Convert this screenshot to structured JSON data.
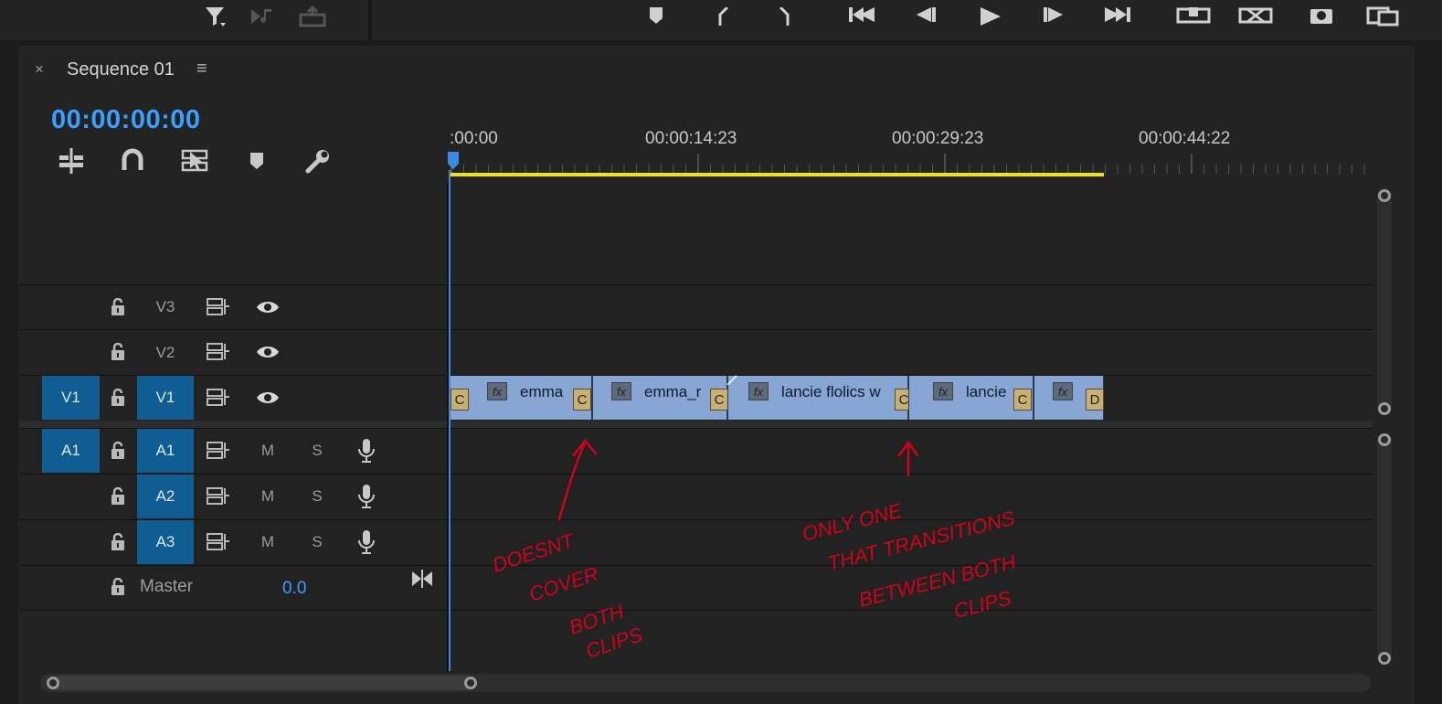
{
  "toolbar": {
    "left_icons": [
      "filter-icon",
      "insert-audio-icon",
      "export-frame-icon"
    ],
    "right_icons": [
      "marker-icon",
      "in-point-icon",
      "out-point-icon",
      "go-to-in-icon",
      "step-back-icon",
      "play-icon",
      "step-forward-icon",
      "go-to-out-icon",
      "insert-icon",
      "overwrite-icon",
      "camera-icon",
      "add-button-icon"
    ]
  },
  "panel": {
    "close_label": "×",
    "title": "Sequence 01",
    "menu_label": "≡",
    "timecode": "00:00:00:00",
    "tools": [
      "insert-edit-icon",
      "snap-magnet-icon",
      "linked-selection-icon",
      "add-marker-icon",
      "settings-wrench-icon"
    ]
  },
  "ruler": {
    "labels": [
      ":00:00",
      "00:00:14:23",
      "00:00:29:23",
      "00:00:44:22"
    ]
  },
  "tracks": {
    "video": [
      {
        "name": "V3",
        "target": "",
        "source_highlighted": false
      },
      {
        "name": "V2",
        "target": "",
        "source_highlighted": false
      },
      {
        "name": "V1",
        "target": "V1",
        "source_highlighted": true
      }
    ],
    "audio": [
      {
        "name": "A1",
        "target": "A1",
        "mute": "M",
        "solo": "S"
      },
      {
        "name": "A2",
        "target": "",
        "mute": "M",
        "solo": "S"
      },
      {
        "name": "A3",
        "target": "",
        "mute": "M",
        "solo": "S"
      }
    ],
    "master": {
      "label": "Master",
      "value": "0.0"
    }
  },
  "clips": [
    {
      "label": "emma",
      "fx": "fx",
      "start_marker": "C",
      "end_marker": "C"
    },
    {
      "label": "emma_r",
      "fx": "fx",
      "end_marker": "C"
    },
    {
      "label": "lancie flolics w",
      "fx": "fx",
      "end_marker": "C"
    },
    {
      "label": "lancie",
      "fx": "fx",
      "end_marker": "C"
    },
    {
      "label": "",
      "fx": "fx",
      "end_marker": "D"
    }
  ],
  "annotations": {
    "left_note": [
      "DOESNT",
      "COVER",
      "BOTH",
      "CLIPS"
    ],
    "right_note": [
      "ONLY ONE",
      "THAT TRANSITIONS",
      "BETWEEN BOTH",
      "CLIPS"
    ],
    "color": "#d0021b"
  },
  "colors": {
    "accent": "#3aa0ff",
    "work_area": "#f2e21a",
    "clip": "#87a6d4",
    "target_track": "#0f5d93"
  }
}
